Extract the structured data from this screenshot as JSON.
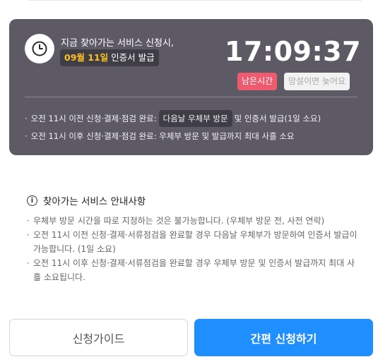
{
  "timer_card": {
    "deadline_line1": "지금 찾아가는 서비스 신청시,",
    "deadline_date": "09월 11일",
    "deadline_suffix": " 인증서 발급",
    "timer": "17:09:37",
    "remain_label": "남은시간",
    "hurry_label": "망설이면 늦어요",
    "rules": [
      {
        "prefix": "오전 11시 이전 신청·결제·점검 완료:",
        "highlight": "다음날 우체부 방문",
        "suffix": "및 인증서 발급(1일 소요)"
      },
      {
        "text": "오전 11시 이후 신청·결제·점검 완료: 우체부 방문 및 발급까지 최대 사흘 소요"
      }
    ]
  },
  "notice": {
    "title": "찾아가는 서비스 안내사항",
    "items": [
      "우체부 방문 시간을 따로 지정하는 것은 불가능합니다. (우체부 방문 전, 사전 연락)",
      "오전 11시 이전 신청·결제·서류점검을 완료할 경우 다음날 우체부가 방문하여 인증서 발급이 가능합니다. (1일 소요)",
      "오전 11시 이후 신청·결제·서류점검을 완료할 경우 우체부 방문 및 인증서 발급까지 최대 사흘 소요됩니다."
    ]
  },
  "buttons": {
    "guide": "신청가이드",
    "apply": "간편 신청하기"
  },
  "colors": {
    "card_bg": "#5d5a66",
    "date_highlight": "#ffc021",
    "remain_pill": "#ee5a6e",
    "primary": "#1f8fff"
  },
  "icons": {
    "clock": "clock-icon",
    "info": "info-icon"
  },
  "bullet": "·",
  "info_glyph": "i"
}
